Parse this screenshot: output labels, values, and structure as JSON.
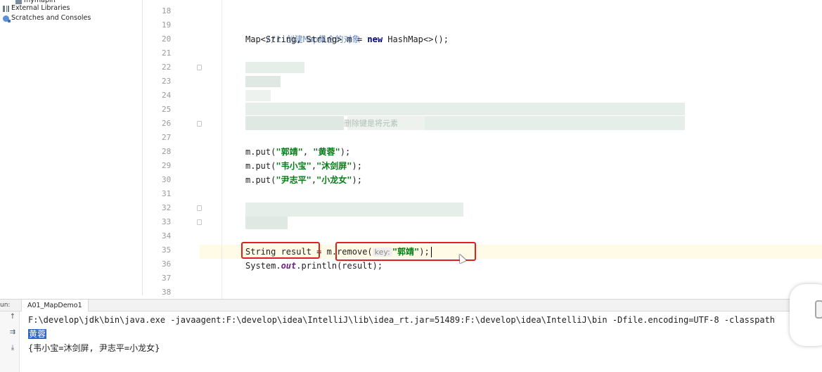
{
  "project_tree": {
    "items": [
      {
        "label": "mymapin",
        "icon": "module-icon"
      },
      {
        "label": "External Libraries",
        "icon": "library-icon"
      },
      {
        "label": "Scratches and Consoles",
        "icon": "scratch-icon"
      }
    ]
  },
  "editor": {
    "line_numbers": [
      "18",
      "19",
      "20",
      "21",
      "22",
      "23",
      "24",
      "25",
      "26",
      "27",
      "28",
      "29",
      "30",
      "31",
      "32",
      "33",
      "34",
      "35",
      "36",
      "37",
      "38"
    ],
    "comment_line": "//1.创建Map集合的对象",
    "line20": {
      "type": "Map<String, String> m = ",
      "kw": "new",
      "rest": " HashMap<>();"
    },
    "blurred_fragment_26": "删除键是将元素",
    "put1": {
      "pre": "m.put(",
      "k": "\"郭靖\"",
      "sep": ", ",
      "v": "\"黄蓉\"",
      "post": ");"
    },
    "put2": {
      "pre": "m.put(",
      "k": "\"韦小宝\"",
      "sep": ",",
      "v": "\"沐剑屏\"",
      "post": ");"
    },
    "put3": {
      "pre": "m.put(",
      "k": "\"尹志平\"",
      "sep": ",",
      "v": "\"小龙女\"",
      "post": ");"
    },
    "line35": {
      "decl": "String result",
      "eq": " = ",
      "m": "m",
      "call": ".remove(",
      "hint": "key:",
      "arg": "\"郭靖\"",
      "end": ");"
    },
    "line36": {
      "pre": "System.",
      "out": "out",
      "post": ".println(result);"
    }
  },
  "run": {
    "label": "un:",
    "tab": "A01_MapDemo1",
    "command": "F:\\develop\\jdk\\bin\\java.exe -javaagent:F:\\develop\\idea\\IntelliJ\\lib\\idea_rt.jar=51489:F:\\develop\\idea\\IntelliJ\\bin -Dfile.encoding=UTF-8 -classpath",
    "output_removed": "黄蓉",
    "output_map": "{韦小宝=沐剑屏, 尹志平=小龙女}"
  },
  "colors": {
    "annotation": "#e0201a",
    "keyword": "#00007f",
    "string": "#067d17",
    "comment": "#6a8cc0",
    "selection": "#2f65ca"
  }
}
